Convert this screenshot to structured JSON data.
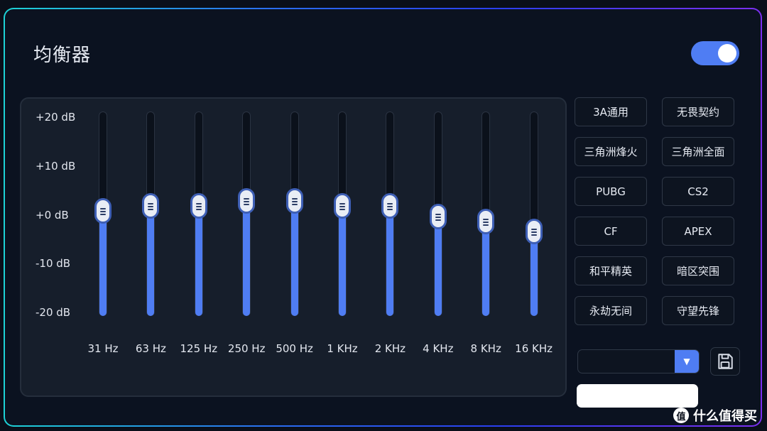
{
  "title": "均衡器",
  "enabled": true,
  "db_labels": [
    "+20 dB",
    "+10 dB",
    "+0 dB",
    "-10 dB",
    "-20 dB"
  ],
  "db_range": [
    -20,
    20
  ],
  "bands": [
    {
      "label": "31 Hz",
      "gain": 0.5
    },
    {
      "label": "63 Hz",
      "gain": 1.5
    },
    {
      "label": "125 Hz",
      "gain": 1.5
    },
    {
      "label": "250 Hz",
      "gain": 2.5
    },
    {
      "label": "500 Hz",
      "gain": 2.5
    },
    {
      "label": "1 KHz",
      "gain": 1.5
    },
    {
      "label": "2 KHz",
      "gain": 1.5
    },
    {
      "label": "4 KHz",
      "gain": -0.5
    },
    {
      "label": "8 KHz",
      "gain": -1.5
    },
    {
      "label": "16 KHz",
      "gain": -3.5
    }
  ],
  "presets": [
    "3A通用",
    "无畏契约",
    "三角洲烽火",
    "三角洲全面",
    "PUBG",
    "CS2",
    "CF",
    "APEX",
    "和平精英",
    "暗区突围",
    "永劫无间",
    "守望先锋"
  ],
  "preset_select": {
    "value": "",
    "icon": "caret-down-icon"
  },
  "save_icon": "floppy-disk-icon",
  "name_input": {
    "value": "",
    "placeholder": ""
  },
  "watermark": {
    "badge": "值",
    "text": "什么值得买"
  },
  "colors": {
    "accent": "#4f7df3",
    "background": "#0b1220",
    "panel": "#161e2b"
  }
}
